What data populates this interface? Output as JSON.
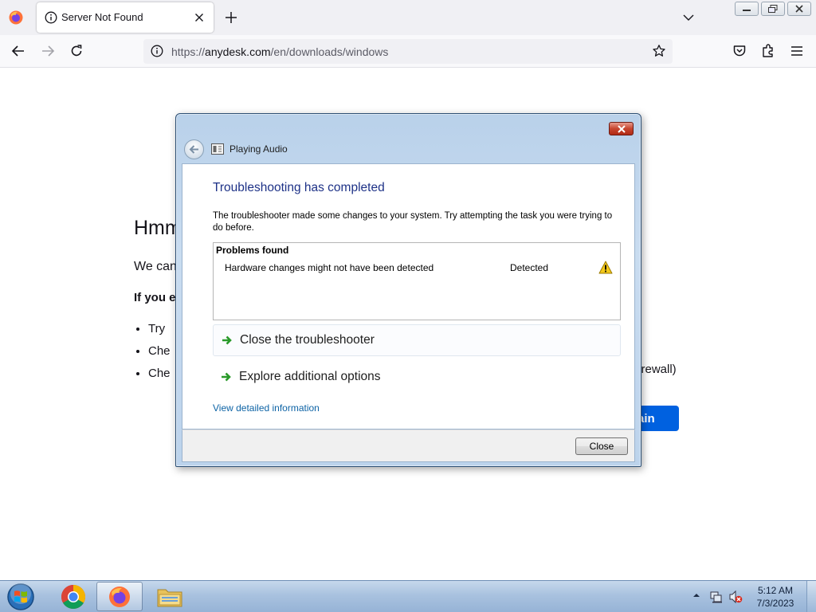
{
  "browser": {
    "tab": {
      "title": "Server Not Found"
    },
    "address": {
      "prefix": "https://",
      "host": "anydesk.com",
      "path": "/en/downloads/windows"
    }
  },
  "page": {
    "title_partial": "Hmm",
    "desc_partial": "We can",
    "hint_partial": "If you e",
    "bullets": [
      "Try",
      "Che",
      "Che"
    ],
    "firewall_fragment": "firewall)",
    "retry_partial": "ain"
  },
  "dialog": {
    "title": "Playing Audio",
    "heading": "Troubleshooting has completed",
    "description": "The troubleshooter made some changes to your system. Try attempting the task you were trying to do before.",
    "problems": {
      "header": "Problems found",
      "items": [
        {
          "name": "Hardware changes might not have been detected",
          "status": "Detected"
        }
      ]
    },
    "options": [
      {
        "label": "Close the troubleshooter"
      },
      {
        "label": "Explore additional options"
      }
    ],
    "details_link": "View detailed information",
    "close_button": "Close"
  },
  "taskbar": {
    "time": "5:12 AM",
    "date": "7/3/2023"
  },
  "colors": {
    "firefox_accent": "#0061e0",
    "dialog_heading": "#1e3287",
    "link": "#0d63a5"
  },
  "icons": [
    "firefox-icon",
    "info-icon",
    "close-icon",
    "plus-icon",
    "chevron-down-icon",
    "back-arrow-icon",
    "forward-arrow-icon",
    "reload-icon",
    "star-icon",
    "pocket-icon",
    "extensions-icon",
    "hamburger-menu-icon",
    "warning-icon",
    "green-arrow-icon",
    "windows-start-icon",
    "chrome-icon",
    "folder-icon",
    "network-icon",
    "speaker-muted-icon"
  ]
}
